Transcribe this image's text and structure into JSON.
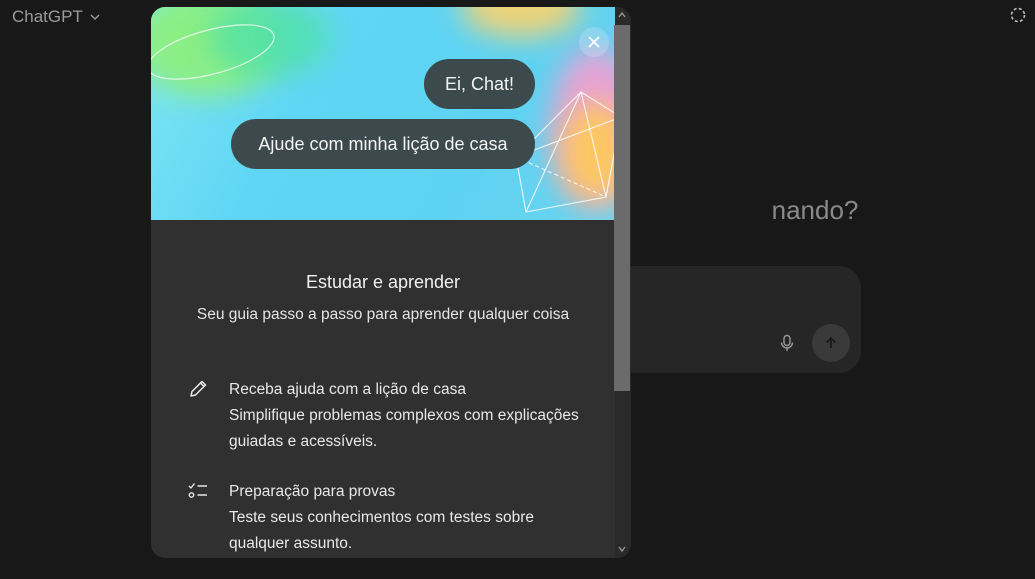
{
  "app": {
    "title": "ChatGPT",
    "heading_fragment": "nando?"
  },
  "modal": {
    "bubble_1": "Ei, Chat!",
    "bubble_2": "Ajude com minha lição de casa",
    "title": "Estudar e aprender",
    "subtitle": "Seu guia passo a passo para aprender qualquer coisa",
    "features": [
      {
        "icon": "pencil-icon",
        "title": "Receba ajuda com a lição de casa",
        "description": "Simplifique problemas complexos com explicações guiadas e acessíveis."
      },
      {
        "icon": "checklist-icon",
        "title": "Preparação para provas",
        "description": "Teste seus conhecimentos com testes sobre qualquer assunto."
      }
    ]
  },
  "colors": {
    "background": "#181818",
    "modal": "#303030",
    "bubble": "#3c4a4e",
    "hero": "#5fd6f5"
  }
}
